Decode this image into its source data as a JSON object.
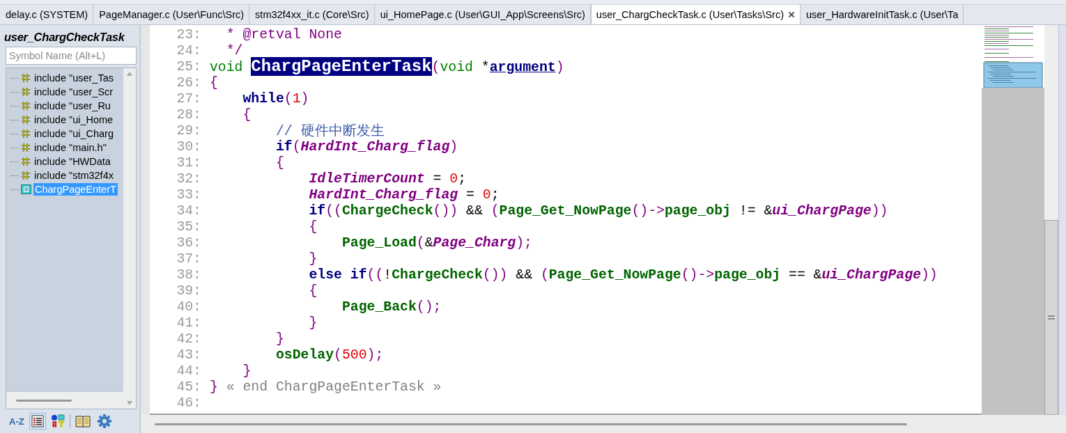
{
  "tabs": [
    {
      "label": "delay.c (SYSTEM)",
      "selected": false
    },
    {
      "label": "PageManager.c (User\\Func\\Src)",
      "selected": false
    },
    {
      "label": "stm32f4xx_it.c (Core\\Src)",
      "selected": false
    },
    {
      "label": "ui_HomePage.c (User\\GUI_App\\Screens\\Src)",
      "selected": false
    },
    {
      "label": "user_ChargCheckTask.c (User\\Tasks\\Src)",
      "selected": true
    },
    {
      "label": "user_HardwareInitTask.c (User\\Ta",
      "selected": false
    }
  ],
  "outline": {
    "title": "user_ChargCheckTask",
    "search": {
      "placeholder": "Symbol Name (Alt+L)"
    },
    "items": [
      {
        "kind": "include",
        "label": "include \"user_Tas",
        "selected": false
      },
      {
        "kind": "include",
        "label": "include \"user_Scr",
        "selected": false
      },
      {
        "kind": "include",
        "label": "include \"user_Ru",
        "selected": false
      },
      {
        "kind": "include",
        "label": "include \"ui_Home",
        "selected": false
      },
      {
        "kind": "include",
        "label": "include \"ui_Charg",
        "selected": false
      },
      {
        "kind": "include",
        "label": "include \"main.h\"",
        "selected": false
      },
      {
        "kind": "include",
        "label": "include \"HWData",
        "selected": false
      },
      {
        "kind": "include",
        "label": "include \"stm32f4x",
        "selected": false
      },
      {
        "kind": "function",
        "label": "ChargPageEnterT",
        "selected": true
      }
    ],
    "toolbar": [
      {
        "kind": "sort",
        "label": "A-Z",
        "selected": false
      },
      {
        "kind": "list",
        "selected": true
      },
      {
        "kind": "symbols",
        "selected": false
      },
      {
        "kind": "book",
        "selected": false
      },
      {
        "kind": "settings",
        "selected": false
      }
    ]
  },
  "editor": {
    "lines": [
      {
        "number": "23:",
        "tokens": [
          {
            "text": "  * @retval None",
            "kind": "comment"
          }
        ]
      },
      {
        "number": "24:",
        "tokens": [
          {
            "text": "  */",
            "kind": "comment"
          }
        ]
      },
      {
        "number": "25:",
        "tokens": [
          {
            "text": "void ",
            "kind": "type"
          },
          {
            "text": "ChargPageEnterTask",
            "kind": "highlight"
          },
          {
            "text": "(",
            "kind": "paren"
          },
          {
            "text": "void",
            "kind": "type"
          },
          {
            "text": " *",
            "kind": "plain"
          },
          {
            "text": "argument",
            "kind": "param"
          },
          {
            "text": ")",
            "kind": "paren"
          }
        ]
      },
      {
        "number": "26:",
        "tokens": [
          {
            "text": "{",
            "kind": "paren"
          }
        ]
      },
      {
        "number": "27:",
        "tokens": [
          {
            "text": "    while",
            "kind": "keyword"
          },
          {
            "text": "(",
            "kind": "paren"
          },
          {
            "text": "1",
            "kind": "number"
          },
          {
            "text": ")",
            "kind": "paren"
          }
        ]
      },
      {
        "number": "28:",
        "tokens": [
          {
            "text": "    {",
            "kind": "paren"
          }
        ]
      },
      {
        "number": "29:",
        "tokens": [
          {
            "text": "        // 硬件中断发生",
            "kind": "comment2"
          }
        ]
      },
      {
        "number": "30:",
        "tokens": [
          {
            "text": "        if",
            "kind": "keyword"
          },
          {
            "text": "(",
            "kind": "paren"
          },
          {
            "text": "HardInt_Charg_flag",
            "kind": "variable"
          },
          {
            "text": ")",
            "kind": "paren"
          }
        ]
      },
      {
        "number": "31:",
        "tokens": [
          {
            "text": "        {",
            "kind": "paren"
          }
        ]
      },
      {
        "number": "32:",
        "tokens": [
          {
            "text": "            IdleTimerCount",
            "kind": "variable"
          },
          {
            "text": " = ",
            "kind": "plain"
          },
          {
            "text": "0",
            "kind": "number"
          },
          {
            "text": ";",
            "kind": "plain"
          }
        ]
      },
      {
        "number": "33:",
        "tokens": [
          {
            "text": "            HardInt_Charg_flag",
            "kind": "variable"
          },
          {
            "text": " = ",
            "kind": "plain"
          },
          {
            "text": "0",
            "kind": "number"
          },
          {
            "text": ";",
            "kind": "plain"
          }
        ]
      },
      {
        "number": "34:",
        "tokens": [
          {
            "text": "            if",
            "kind": "keyword"
          },
          {
            "text": "((",
            "kind": "paren"
          },
          {
            "text": "ChargeCheck",
            "kind": "function"
          },
          {
            "text": "())",
            "kind": "paren"
          },
          {
            "text": " && ",
            "kind": "plain"
          },
          {
            "text": "(",
            "kind": "paren"
          },
          {
            "text": "Page_Get_NowPage",
            "kind": "function"
          },
          {
            "text": "()->",
            "kind": "paren"
          },
          {
            "text": "page_obj",
            "kind": "function"
          },
          {
            "text": " != &",
            "kind": "plain"
          },
          {
            "text": "ui_ChargPage",
            "kind": "variable"
          },
          {
            "text": "))",
            "kind": "paren"
          }
        ]
      },
      {
        "number": "35:",
        "tokens": [
          {
            "text": "            {",
            "kind": "paren"
          }
        ]
      },
      {
        "number": "36:",
        "tokens": [
          {
            "text": "                Page_Load",
            "kind": "function"
          },
          {
            "text": "(",
            "kind": "paren"
          },
          {
            "text": "&",
            "kind": "plain"
          },
          {
            "text": "Page_Charg",
            "kind": "variable"
          },
          {
            "text": ");",
            "kind": "paren"
          }
        ]
      },
      {
        "number": "37:",
        "tokens": [
          {
            "text": "            }",
            "kind": "paren"
          }
        ]
      },
      {
        "number": "38:",
        "tokens": [
          {
            "text": "            else if",
            "kind": "keyword"
          },
          {
            "text": "((",
            "kind": "paren"
          },
          {
            "text": "!",
            "kind": "plain"
          },
          {
            "text": "ChargeCheck",
            "kind": "function"
          },
          {
            "text": "())",
            "kind": "paren"
          },
          {
            "text": " && ",
            "kind": "plain"
          },
          {
            "text": "(",
            "kind": "paren"
          },
          {
            "text": "Page_Get_NowPage",
            "kind": "function"
          },
          {
            "text": "()->",
            "kind": "paren"
          },
          {
            "text": "page_obj",
            "kind": "function"
          },
          {
            "text": " == &",
            "kind": "plain"
          },
          {
            "text": "ui_ChargPage",
            "kind": "variable"
          },
          {
            "text": "))",
            "kind": "paren"
          }
        ]
      },
      {
        "number": "39:",
        "tokens": [
          {
            "text": "            {",
            "kind": "paren"
          }
        ]
      },
      {
        "number": "40:",
        "tokens": [
          {
            "text": "                Page_Back",
            "kind": "function"
          },
          {
            "text": "();",
            "kind": "paren"
          }
        ]
      },
      {
        "number": "41:",
        "tokens": [
          {
            "text": "            }",
            "kind": "paren"
          }
        ]
      },
      {
        "number": "42:",
        "tokens": [
          {
            "text": "        }",
            "kind": "paren"
          }
        ]
      },
      {
        "number": "43:",
        "tokens": [
          {
            "text": "        osDelay",
            "kind": "function"
          },
          {
            "text": "(",
            "kind": "paren"
          },
          {
            "text": "500",
            "kind": "number"
          },
          {
            "text": ");",
            "kind": "paren"
          }
        ]
      },
      {
        "number": "44:",
        "tokens": [
          {
            "text": "    }",
            "kind": "paren"
          }
        ]
      },
      {
        "number": "45:",
        "tokens": [
          {
            "text": "}",
            "kind": "paren"
          },
          {
            "text": " « end ChargPageEnterTask »",
            "kind": "end"
          }
        ]
      },
      {
        "number": "46:"
      }
    ]
  }
}
